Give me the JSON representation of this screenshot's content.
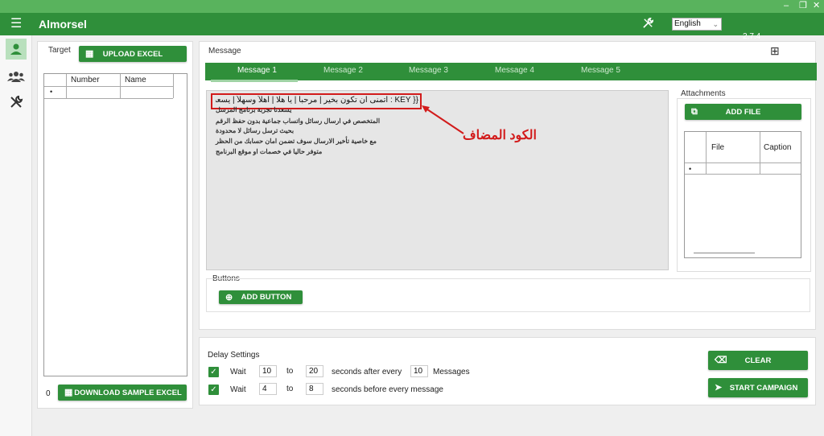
{
  "window": {
    "minimize": "–",
    "restore": "❐",
    "close": "✕"
  },
  "app": {
    "title": "Almorsel",
    "language": "English",
    "version": "2.7.4",
    "accent": "#2f8f3a",
    "titlebar": "#59b35d"
  },
  "sidebar": {
    "items": [
      {
        "icon": "user-icon",
        "active": true
      },
      {
        "icon": "group-icon",
        "active": false
      },
      {
        "icon": "tools-icon",
        "active": false
      }
    ]
  },
  "target": {
    "label": "Target",
    "upload_label": "UPLOAD EXCEL",
    "columns": [
      "Number",
      "Name"
    ],
    "new_row_marker": "•",
    "count": "0",
    "download_label": "DOWNLOAD SAMPLE EXCEL"
  },
  "message": {
    "label": "Message",
    "add_icon": "⊞",
    "tabs": [
      "Message 1",
      "Message 2",
      "Message 3",
      "Message 5",
      "Message 4"
    ],
    "key_text": "{{ KEY : أتمنى ان تكون بخير | مرحباً | يا هلا | أهلاً وسهلاً | يسعد مسائك | يا هلا وغلا }}",
    "lines": [
      "يسعدنا تجربة برنامج المرسل",
      "المتخصص في ارسال رسائل واتساب جماعية بدون حفظ الرقم",
      "بحيث ترسل رسائل لا محدودة",
      "مع خاصية تأخير الارسال سوف تضمن امان حسابك من الحظر",
      "متوفر حاليا في خصمات او موقع البرنامج"
    ],
    "annotation": "الكود المضاف"
  },
  "attachments": {
    "label": "Attachments",
    "add_file_label": "ADD FILE",
    "columns": [
      "File",
      "Caption"
    ],
    "new_row_marker": "•"
  },
  "buttons": {
    "label": "Buttons",
    "add_button_label": "ADD BUTTON"
  },
  "delay": {
    "label": "Delay Settings",
    "row1": {
      "wait": "Wait",
      "from": "10",
      "to_word": "to",
      "to": "20",
      "suffix": "seconds after every",
      "count": "10",
      "unit": "Messages"
    },
    "row2": {
      "wait": "Wait",
      "from": "4",
      "to_word": "to",
      "to": "8",
      "suffix": "seconds before every message"
    }
  },
  "actions": {
    "clear_label": "CLEAR",
    "start_label": "START CAMPAIGN"
  }
}
